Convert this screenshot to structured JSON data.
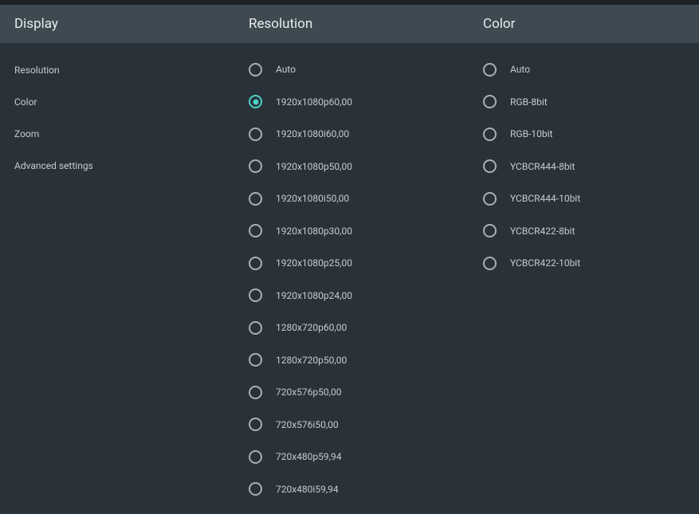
{
  "headers": {
    "display": "Display",
    "resolution": "Resolution",
    "color": "Color"
  },
  "displayMenu": [
    {
      "label": "Resolution"
    },
    {
      "label": "Color"
    },
    {
      "label": "Zoom"
    },
    {
      "label": "Advanced settings"
    }
  ],
  "resolutionOptions": [
    {
      "label": "Auto",
      "selected": false
    },
    {
      "label": "1920x1080p60,00",
      "selected": true
    },
    {
      "label": "1920x1080i60,00",
      "selected": false
    },
    {
      "label": "1920x1080p50,00",
      "selected": false
    },
    {
      "label": "1920x1080i50,00",
      "selected": false
    },
    {
      "label": "1920x1080p30,00",
      "selected": false
    },
    {
      "label": "1920x1080p25,00",
      "selected": false
    },
    {
      "label": "1920x1080p24,00",
      "selected": false
    },
    {
      "label": "1280x720p60,00",
      "selected": false
    },
    {
      "label": "1280x720p50,00",
      "selected": false
    },
    {
      "label": "720x576p50,00",
      "selected": false
    },
    {
      "label": "720x576i50,00",
      "selected": false
    },
    {
      "label": "720x480p59,94",
      "selected": false
    },
    {
      "label": "720x480i59,94",
      "selected": false
    }
  ],
  "colorOptions": [
    {
      "label": "Auto",
      "selected": false
    },
    {
      "label": "RGB-8bit",
      "selected": false
    },
    {
      "label": "RGB-10bit",
      "selected": false
    },
    {
      "label": "YCBCR444-8bit",
      "selected": false
    },
    {
      "label": "YCBCR444-10bit",
      "selected": false
    },
    {
      "label": "YCBCR422-8bit",
      "selected": false
    },
    {
      "label": "YCBCR422-10bit",
      "selected": false
    }
  ]
}
